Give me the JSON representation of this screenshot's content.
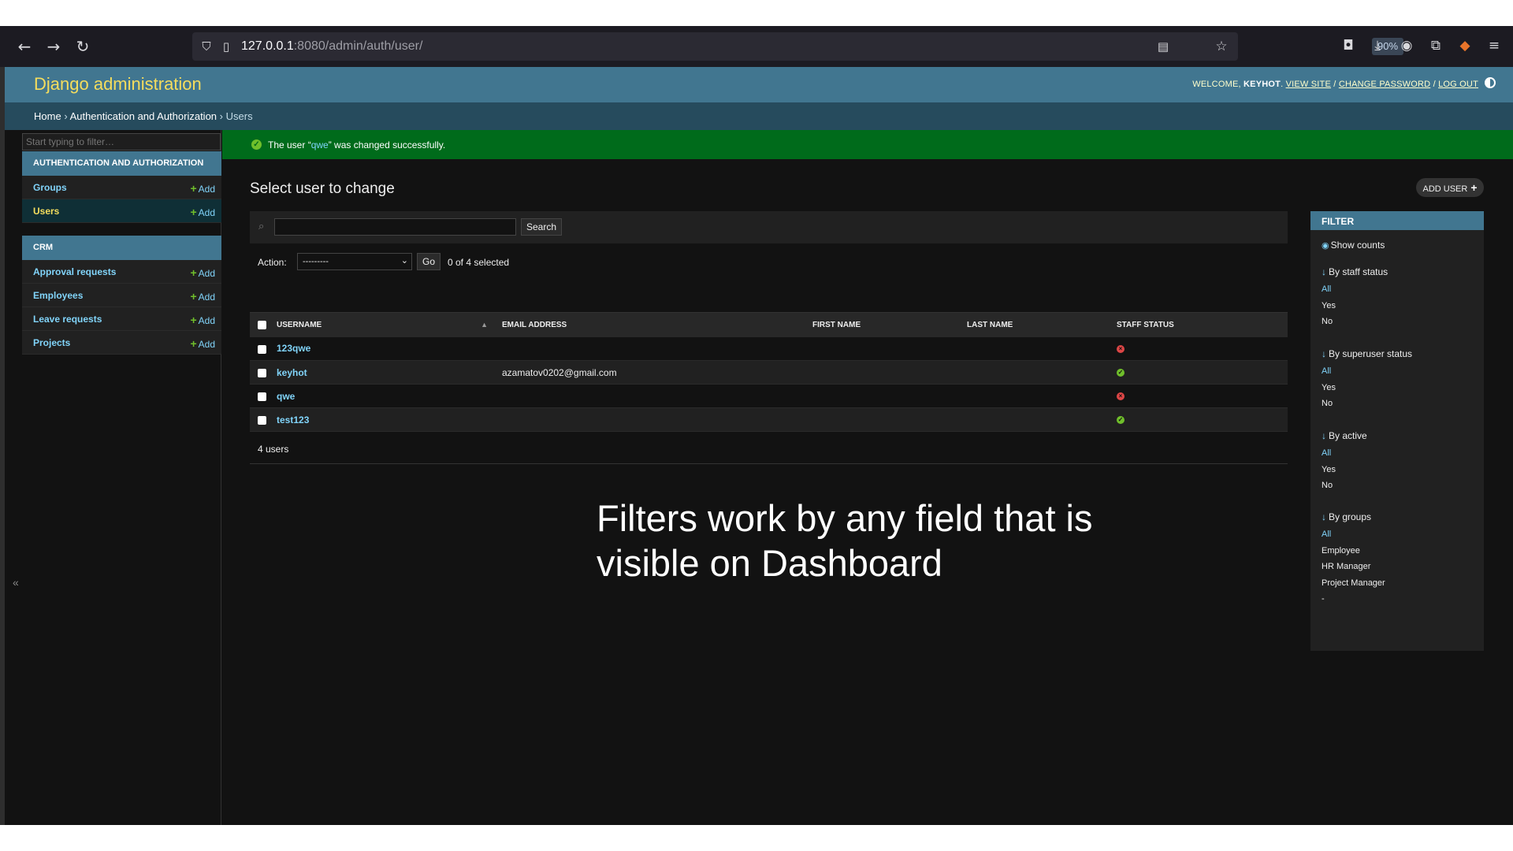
{
  "browser": {
    "url_host": "127.0.0.1",
    "url_rest": ":8080/admin/auth/user/",
    "zoom": "90%"
  },
  "header": {
    "site_name": "Django administration",
    "welcome": "WELCOME,",
    "username": "KEYHOT",
    "view_site": "VIEW SITE",
    "change_password": "CHANGE PASSWORD",
    "log_out": "LOG OUT",
    "sep": "/"
  },
  "breadcrumbs": {
    "home": "Home",
    "app": "Authentication and Authorization",
    "current": "Users",
    "sep": "›"
  },
  "sidebar": {
    "filter_placeholder": "Start typing to filter…",
    "collapse": "«",
    "modules": [
      {
        "caption": "Authentication and Authorization",
        "items": [
          {
            "label": "Groups",
            "add": "Add"
          },
          {
            "label": "Users",
            "add": "Add"
          }
        ]
      },
      {
        "caption": "CRM",
        "items": [
          {
            "label": "Approval requests",
            "add": "Add"
          },
          {
            "label": "Employees",
            "add": "Add"
          },
          {
            "label": "Leave requests",
            "add": "Add"
          },
          {
            "label": "Projects",
            "add": "Add"
          }
        ]
      }
    ]
  },
  "message": {
    "prefix": "The user “",
    "name": "qwe",
    "suffix": "” was changed successfully."
  },
  "content": {
    "title": "Select user to change",
    "add_button": "ADD USER",
    "search_button": "Search",
    "search_value": "",
    "action_label": "Action:",
    "action_value": "---------",
    "go_button": "Go",
    "selected_counter": "0 of 4 selected",
    "columns": [
      "Username",
      "Email address",
      "First name",
      "Last name",
      "Staff status"
    ],
    "rows": [
      {
        "username": "123qwe",
        "email": "",
        "first_name": "",
        "last_name": "",
        "staff": false
      },
      {
        "username": "keyhot",
        "email": "azamatov0202@gmail.com",
        "first_name": "",
        "last_name": "",
        "staff": true
      },
      {
        "username": "qwe",
        "email": "",
        "first_name": "",
        "last_name": "",
        "staff": false
      },
      {
        "username": "test123",
        "email": "",
        "first_name": "",
        "last_name": "",
        "staff": true
      }
    ],
    "paginator": "4 users"
  },
  "filter": {
    "caption": "FILTER",
    "show_counts": "Show counts",
    "groups": [
      {
        "heading": "By staff status",
        "options": [
          "All",
          "Yes",
          "No"
        ]
      },
      {
        "heading": "By superuser status",
        "options": [
          "All",
          "Yes",
          "No"
        ]
      },
      {
        "heading": "By active",
        "options": [
          "All",
          "Yes",
          "No"
        ]
      },
      {
        "heading": "By groups",
        "options": [
          "All",
          "Employee",
          "HR Manager",
          "Project Manager",
          "-"
        ]
      }
    ]
  },
  "caption_overlay": "Filters work by any field that is visible on Dashboard",
  "colors": {
    "header_bg": "#417690",
    "site_name": "#f5dd5d",
    "link": "#81d4fa",
    "success_bg": "#006b1b",
    "yes_icon": "#70bf2b",
    "no_icon": "#dd4646"
  }
}
